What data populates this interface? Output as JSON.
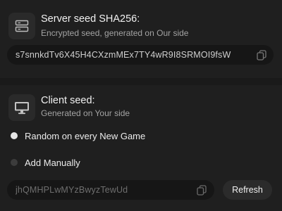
{
  "server_seed": {
    "title": "Server seed SHA256:",
    "subtitle": "Encrypted seed, generated on Our side",
    "value": "s7snnkdTv6X45H4CXzmMEx7TY4wR9I8SRMOI9fsW",
    "icon": "server-icon",
    "copy_icon": "copy-icon"
  },
  "client_seed": {
    "title": "Client seed:",
    "subtitle": "Generated on Your side",
    "icon": "monitor-icon",
    "options": [
      {
        "label": "Random on every New Game",
        "selected": true
      },
      {
        "label": "Add Manually",
        "selected": false
      }
    ],
    "placeholder": "jhQMHPLwMYzBwyzTewUd",
    "copy_icon": "copy-icon",
    "refresh_label": "Refresh"
  }
}
